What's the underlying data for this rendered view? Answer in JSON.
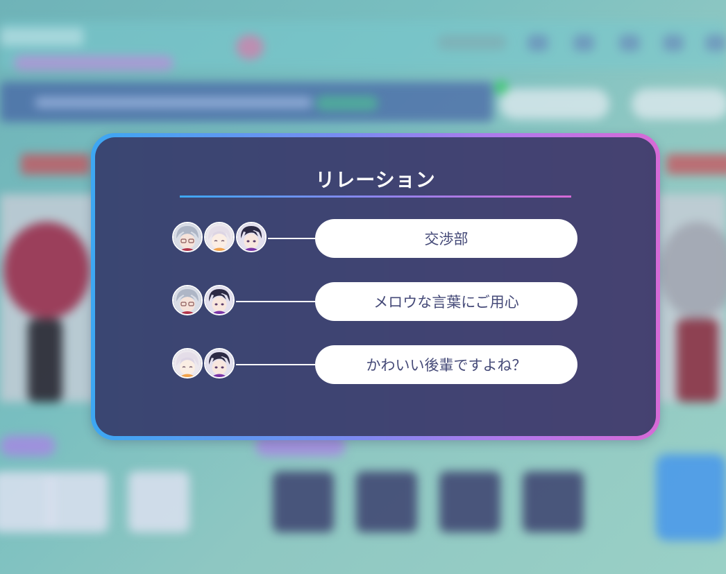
{
  "modal": {
    "title": "リレーション",
    "border_gradient": [
      "#3da7f2",
      "#d66ad6"
    ],
    "background": "#3a3e68"
  },
  "relations": [
    {
      "label": "交渉部",
      "members": [
        "silver-haired-glasses-character",
        "white-haired-character",
        "dark-haired-character"
      ]
    },
    {
      "label": "メロウな言葉にご用心",
      "members": [
        "silver-haired-glasses-character",
        "dark-haired-character"
      ]
    },
    {
      "label": "かわいい後輩ですよね？",
      "members": [
        "white-haired-character",
        "dark-haired-character"
      ]
    }
  ]
}
